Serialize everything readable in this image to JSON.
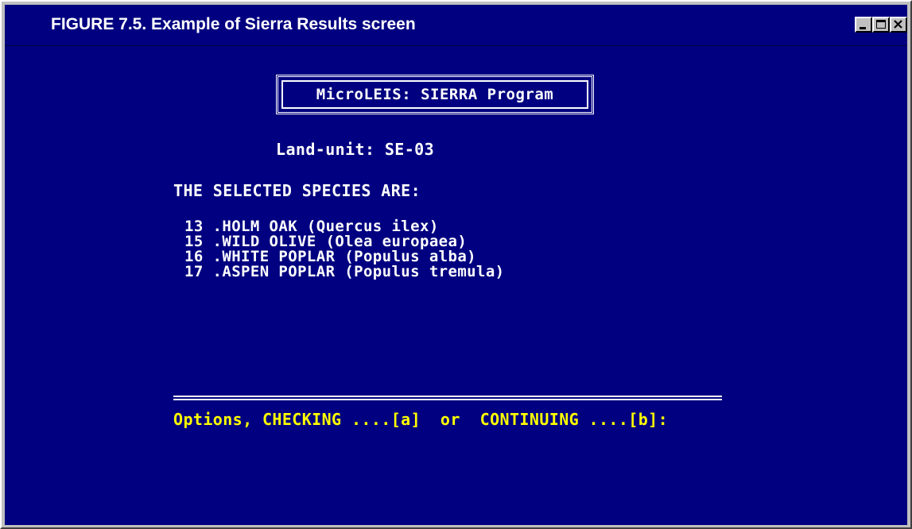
{
  "window": {
    "title": "FIGURE 7.5. Example of Sierra Results screen",
    "controls": {
      "minimize_icon": "minimize-icon",
      "maximize_icon": "maximize-icon",
      "close_icon": "close-icon"
    }
  },
  "screen": {
    "banner": "MicroLEIS: SIERRA Program",
    "land_unit": "Land-unit: SE-03",
    "selected_heading": "THE SELECTED SPECIES ARE:",
    "species": [
      {
        "text": "13 .HOLM OAK (Quercus ilex)"
      },
      {
        "text": "15 .WILD OLIVE (Olea europaea)"
      },
      {
        "text": "16 .WHITE POPLAR (Populus alba)"
      },
      {
        "text": "17 .ASPEN POPLAR (Populus tremula)"
      }
    ],
    "options_prompt": "Options, CHECKING ....[a]  or  CONTINUING ....[b]:"
  },
  "colors": {
    "screen_background": "#000080",
    "text": "#ffffff",
    "prompt_text": "#ffff00",
    "window_frame": "#c0c0c0"
  }
}
